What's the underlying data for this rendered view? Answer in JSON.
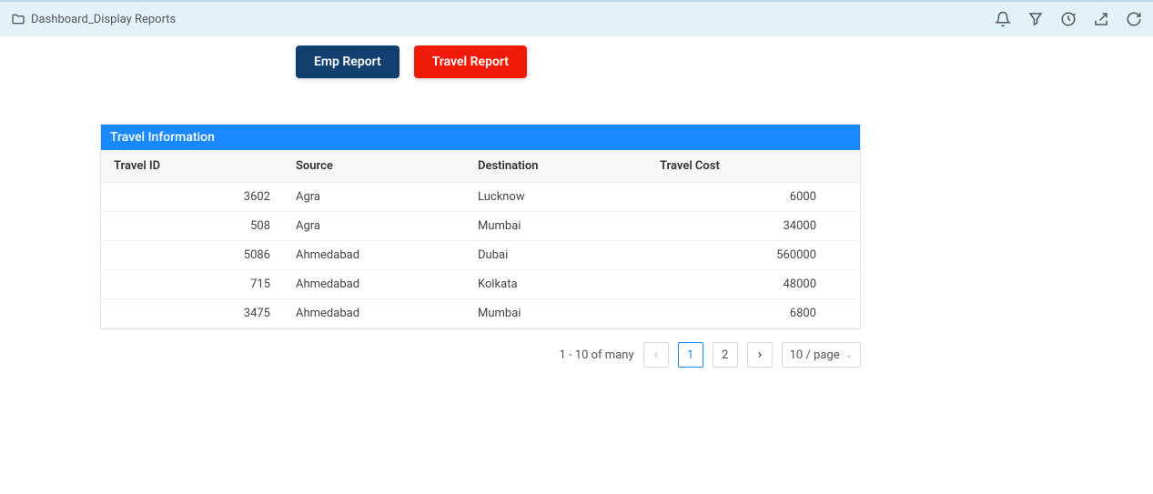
{
  "header": {
    "title": "Dashboard_Display Reports"
  },
  "buttons": {
    "emp_report": "Emp Report",
    "travel_report": "Travel Report"
  },
  "panel": {
    "title": "Travel Information",
    "columns": {
      "travel_id": "Travel ID",
      "source": "Source",
      "destination": "Destination",
      "travel_cost": "Travel Cost"
    },
    "rows": [
      {
        "id": "3602",
        "source": "Agra",
        "destination": "Lucknow",
        "cost": "6000"
      },
      {
        "id": "508",
        "source": "Agra",
        "destination": "Mumbai",
        "cost": "34000"
      },
      {
        "id": "5086",
        "source": "Ahmedabad",
        "destination": "Dubai",
        "cost": "560000"
      },
      {
        "id": "715",
        "source": "Ahmedabad",
        "destination": "Kolkata",
        "cost": "48000"
      },
      {
        "id": "3475",
        "source": "Ahmedabad",
        "destination": "Mumbai",
        "cost": "6800"
      }
    ]
  },
  "pagination": {
    "summary": "1 - 10 of many",
    "pages": [
      "1",
      "2"
    ],
    "current": "1",
    "page_size": "10 / page"
  }
}
